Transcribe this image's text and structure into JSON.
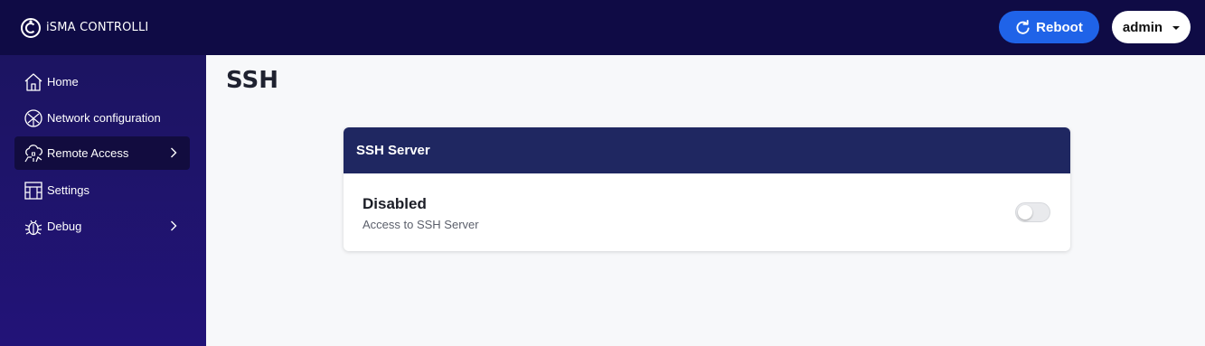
{
  "header": {
    "brand_name": "iSMA CONTROLLI",
    "reboot_label": "Reboot",
    "user_label": "admin"
  },
  "sidebar": {
    "items": [
      {
        "label": "Home",
        "icon": "home-icon"
      },
      {
        "label": "Network configuration",
        "icon": "network-icon"
      },
      {
        "label": "Remote Access",
        "icon": "remote-access-icon",
        "active": true,
        "has_submenu": true
      },
      {
        "label": "Settings",
        "icon": "settings-icon"
      },
      {
        "label": "Debug",
        "icon": "bug-icon",
        "has_submenu": true
      }
    ]
  },
  "main": {
    "title": "SSH",
    "card": {
      "header": "SSH Server",
      "status": "Disabled",
      "description": "Access to SSH Server",
      "toggle_on": false
    }
  },
  "colors": {
    "topbar": "#0f0b45",
    "sidebar": "#1c1461",
    "accent": "#1f63e8",
    "card_header": "#1f2761"
  }
}
